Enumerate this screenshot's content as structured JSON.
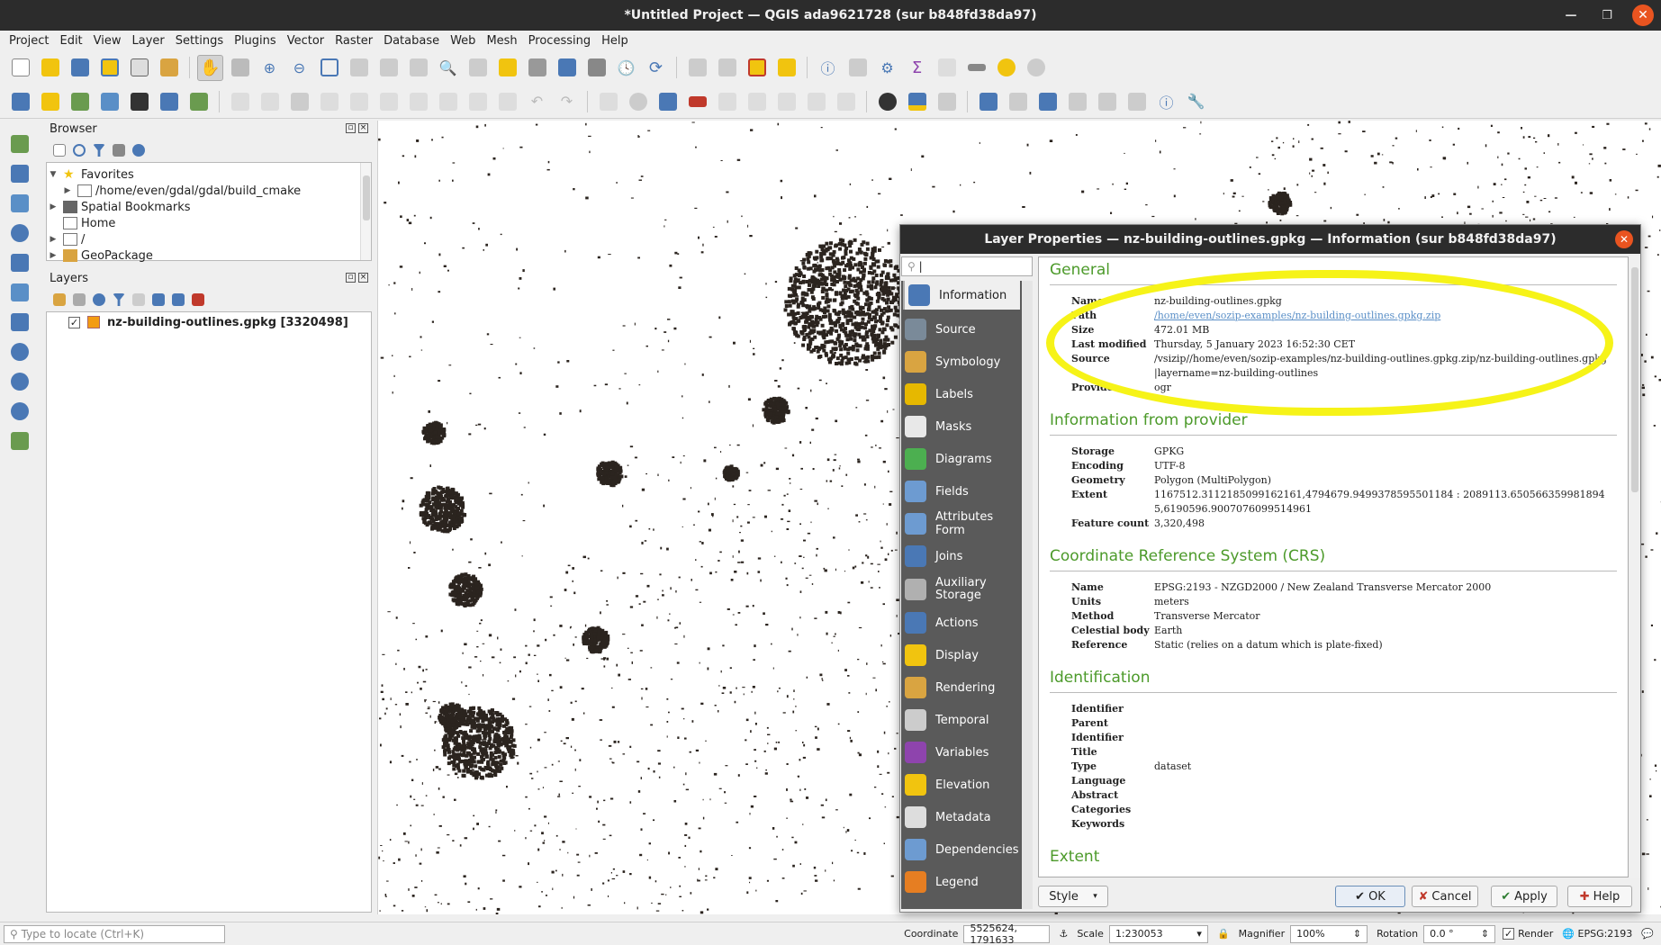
{
  "window": {
    "title": "*Untitled Project — QGIS ada9621728 (sur b848fd38da97)"
  },
  "menu": [
    "Project",
    "Edit",
    "View",
    "Layer",
    "Settings",
    "Plugins",
    "Vector",
    "Raster",
    "Database",
    "Web",
    "Mesh",
    "Processing",
    "Help"
  ],
  "browser": {
    "title": "Browser",
    "items": [
      {
        "label": "Favorites",
        "icon": "star-icon"
      },
      {
        "label": "/home/even/gdal/gdal/build_cmake",
        "icon": "folder-icon"
      },
      {
        "label": "Spatial Bookmarks",
        "icon": "bookmark-icon"
      },
      {
        "label": "Home",
        "icon": "folder-icon"
      },
      {
        "label": "/",
        "icon": "folder-icon"
      },
      {
        "label": "GeoPackage",
        "icon": "geopackage-icon"
      }
    ]
  },
  "layers": {
    "title": "Layers",
    "items": [
      {
        "label": "nz-building-outlines.gpkg [3320498]",
        "checked": true,
        "color": "#f39c12"
      }
    ]
  },
  "dialog": {
    "title": "Layer Properties — nz-building-outlines.gpkg — Information (sur b848fd38da97)",
    "nav": [
      {
        "label": "Information",
        "icon": "information-icon",
        "color": "#4a78b5"
      },
      {
        "label": "Source",
        "icon": "source-icon",
        "color": "#7a8a99"
      },
      {
        "label": "Symbology",
        "icon": "symbology-icon",
        "color": "#d9a441"
      },
      {
        "label": "Labels",
        "icon": "labels-icon",
        "color": "#e6b800"
      },
      {
        "label": "Masks",
        "icon": "masks-icon",
        "color": "#e8e8e8"
      },
      {
        "label": "Diagrams",
        "icon": "diagrams-icon",
        "color": "#4caf50"
      },
      {
        "label": "Fields",
        "icon": "fields-icon",
        "color": "#6d9bd1"
      },
      {
        "label": "Attributes Form",
        "icon": "attributes-form-icon",
        "color": "#6d9bd1"
      },
      {
        "label": "Joins",
        "icon": "joins-icon",
        "color": "#4a78b5"
      },
      {
        "label": "Auxiliary Storage",
        "icon": "auxiliary-storage-icon",
        "color": "#b0b0b0"
      },
      {
        "label": "Actions",
        "icon": "actions-icon",
        "color": "#4a78b5"
      },
      {
        "label": "Display",
        "icon": "display-icon",
        "color": "#f1c40f"
      },
      {
        "label": "Rendering",
        "icon": "rendering-icon",
        "color": "#d9a441"
      },
      {
        "label": "Temporal",
        "icon": "temporal-icon",
        "color": "#cccccc"
      },
      {
        "label": "Variables",
        "icon": "variables-icon",
        "color": "#8e44ad"
      },
      {
        "label": "Elevation",
        "icon": "elevation-icon",
        "color": "#f1c40f"
      },
      {
        "label": "Metadata",
        "icon": "metadata-icon",
        "color": "#dddddd"
      },
      {
        "label": "Dependencies",
        "icon": "dependencies-icon",
        "color": "#6d9bd1"
      },
      {
        "label": "Legend",
        "icon": "legend-icon",
        "color": "#e67e22"
      }
    ],
    "general": {
      "title": "General",
      "rows": [
        {
          "k": "Name",
          "v": "nz-building-outlines.gpkg"
        },
        {
          "k": "Path",
          "v": "/home/even/sozip-examples/nz-building-outlines.gpkg.zip",
          "link": true
        },
        {
          "k": "Size",
          "v": "472.01 MB"
        },
        {
          "k": "Last modified",
          "v": "Thursday, 5 January 2023 16:52:30 CET"
        },
        {
          "k": "Source",
          "v": "/vsizip//home/even/sozip-examples/nz-building-outlines.gpkg.zip/nz-building-outlines.gpkg|layername=nz-building-outlines"
        },
        {
          "k": "Provider",
          "v": "ogr"
        }
      ]
    },
    "provider": {
      "title": "Information from provider",
      "rows": [
        {
          "k": "Storage",
          "v": "GPKG"
        },
        {
          "k": "Encoding",
          "v": "UTF-8"
        },
        {
          "k": "Geometry",
          "v": "Polygon (MultiPolygon)"
        },
        {
          "k": "Extent",
          "v": "1167512.3112185099162161,4794679.9499378595501184 : 2089113.6505663599818945,6190596.9007076099514961"
        },
        {
          "k": "Feature count",
          "v": "3,320,498"
        }
      ]
    },
    "crs": {
      "title": "Coordinate Reference System (CRS)",
      "rows": [
        {
          "k": "Name",
          "v": "EPSG:2193 - NZGD2000 / New Zealand Transverse Mercator 2000"
        },
        {
          "k": "Units",
          "v": "meters"
        },
        {
          "k": "Method",
          "v": "Transverse Mercator"
        },
        {
          "k": "Celestial body",
          "v": "Earth"
        },
        {
          "k": "Reference",
          "v": "Static (relies on a datum which is plate-fixed)"
        }
      ]
    },
    "identification": {
      "title": "Identification",
      "rows": [
        {
          "k": "Identifier",
          "v": ""
        },
        {
          "k": "Parent Identifier",
          "v": ""
        },
        {
          "k": "Title",
          "v": ""
        },
        {
          "k": "Type",
          "v": "dataset"
        },
        {
          "k": "Language",
          "v": ""
        },
        {
          "k": "Abstract",
          "v": ""
        },
        {
          "k": "Categories",
          "v": ""
        },
        {
          "k": "Keywords",
          "v": ""
        }
      ]
    },
    "extent_title": "Extent",
    "buttons": {
      "style": "Style",
      "ok": "OK",
      "cancel": "Cancel",
      "apply": "Apply",
      "help": "Help"
    },
    "search_placeholder": ""
  },
  "status": {
    "locate_placeholder": "Type to locate (Ctrl+K)",
    "coordinate_label": "Coordinate",
    "coordinate_value": "5525624, 1791633",
    "scale_label": "Scale",
    "scale_value": "1:230053",
    "magnifier_label": "Magnifier",
    "magnifier_value": "100%",
    "rotation_label": "Rotation",
    "rotation_value": "0.0 °",
    "render_label": "Render",
    "crs": "EPSG:2193"
  },
  "colors": {
    "highlight": "#f6f318",
    "section_title": "#4c9a2a",
    "nav_bg": "#5a5a5a",
    "titlebar": "#2c2c2c"
  }
}
